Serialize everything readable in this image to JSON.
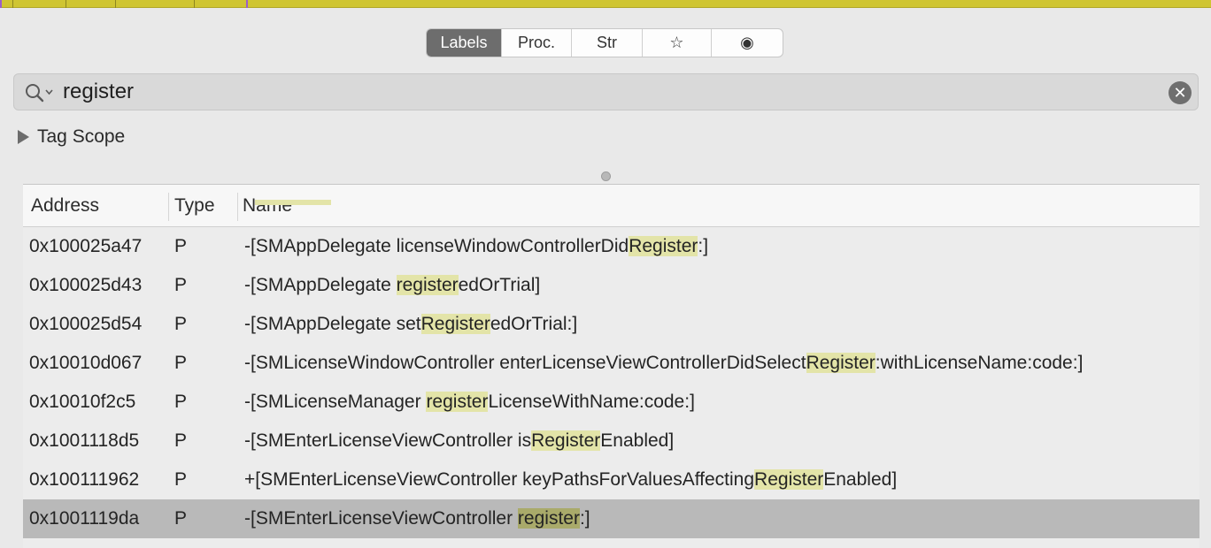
{
  "segments": [
    "Labels",
    "Proc.",
    "Str",
    "☆",
    "◉"
  ],
  "segments_active_index": 0,
  "search": {
    "query": "register",
    "clear_glyph": "✕"
  },
  "tag_scope": {
    "label": "Tag Scope"
  },
  "table": {
    "columns": [
      "Address",
      "Type",
      "Name"
    ],
    "rows": [
      {
        "address": "0x100025a47",
        "type": "P",
        "name": [
          "-[SMAppDelegate licenseWindowControllerDid",
          "Register",
          ":]"
        ]
      },
      {
        "address": "0x100025d43",
        "type": "P",
        "name": [
          "-[SMAppDelegate ",
          "register",
          "edOrTrial]"
        ]
      },
      {
        "address": "0x100025d54",
        "type": "P",
        "name": [
          "-[SMAppDelegate set",
          "Register",
          "edOrTrial:]"
        ]
      },
      {
        "address": "0x10010d067",
        "type": "P",
        "name": [
          "-[SMLicenseWindowController enterLicenseViewControllerDidSelect",
          "Register",
          ":withLicenseName:code:]"
        ]
      },
      {
        "address": "0x10010f2c5",
        "type": "P",
        "name": [
          "-[SMLicenseManager ",
          "register",
          "LicenseWithName:code:]"
        ]
      },
      {
        "address": "0x1001118d5",
        "type": "P",
        "name": [
          "-[SMEnterLicenseViewController is",
          "Register",
          "Enabled]"
        ]
      },
      {
        "address": "0x100111962",
        "type": "P",
        "name": [
          "+[SMEnterLicenseViewController keyPathsForValuesAffecting",
          "Register",
          "Enabled]"
        ]
      },
      {
        "address": "0x1001119da",
        "type": "P",
        "name": [
          "-[SMEnterLicenseViewController ",
          "register",
          ":]"
        ]
      }
    ],
    "selected_row_index": 7
  },
  "colors": {
    "top_strip": "#cfc532",
    "highlight": "#e3e4a8",
    "selected_row": "#b9b9b9",
    "active_segment": "#6d6d6d"
  }
}
